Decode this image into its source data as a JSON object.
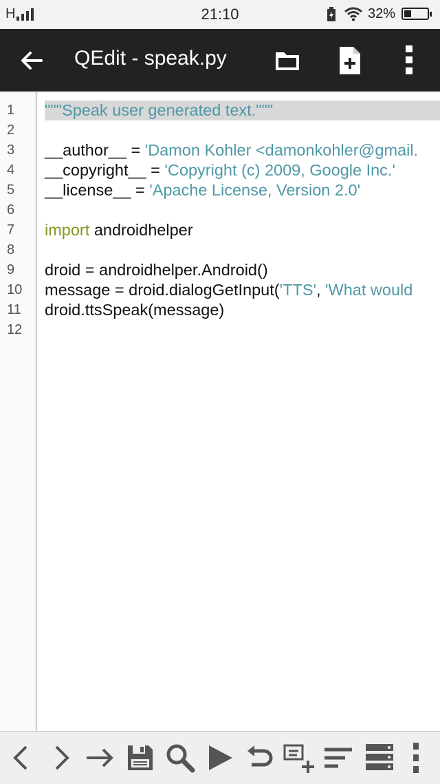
{
  "status_bar": {
    "network": "H",
    "time": "21:10",
    "battery_percent": "32%",
    "battery_level": 0.32,
    "icons": [
      "signal-icon",
      "battery-saver-icon",
      "wifi-icon",
      "battery-icon"
    ]
  },
  "app_bar": {
    "title": "QEdit - speak.py",
    "icons": [
      "back-arrow-icon",
      "folder-icon",
      "new-file-icon",
      "overflow-menu-icon"
    ]
  },
  "editor": {
    "line_numbers": [
      "1",
      "2",
      "3",
      "4",
      "5",
      "6",
      "7",
      "8",
      "9",
      "10",
      "11",
      "12"
    ],
    "current_line": 1,
    "lines": [
      [
        {
          "t": "str",
          "v": "\"\"\"Speak user generated text.\"\"\""
        }
      ],
      [],
      [
        {
          "t": "plain",
          "v": "__author__ = "
        },
        {
          "t": "str",
          "v": "'Damon Kohler <damonkohler@gmail."
        }
      ],
      [
        {
          "t": "plain",
          "v": "__copyright__ = "
        },
        {
          "t": "str",
          "v": "'Copyright (c) 2009, Google Inc.'"
        }
      ],
      [
        {
          "t": "plain",
          "v": "__license__ = "
        },
        {
          "t": "str",
          "v": "'Apache License, Version 2.0'"
        }
      ],
      [],
      [
        {
          "t": "kw",
          "v": "import"
        },
        {
          "t": "plain",
          "v": " androidhelper"
        }
      ],
      [],
      [
        {
          "t": "plain",
          "v": "droid = androidhelper.Android()"
        }
      ],
      [
        {
          "t": "plain",
          "v": "message = droid.dialogGetInput("
        },
        {
          "t": "str",
          "v": "'TTS'"
        },
        {
          "t": "plain",
          "v": ", "
        },
        {
          "t": "str",
          "v": "'What would"
        }
      ],
      [
        {
          "t": "plain",
          "v": "droid.ttsSpeak(message)"
        }
      ],
      []
    ],
    "colors": {
      "string": "#4f98a7",
      "keyword": "#7f9a1f",
      "text": "#111111",
      "current_line_bg": "#d8d8d8"
    }
  },
  "toolbar": {
    "icons": [
      "chevron-left-icon",
      "chevron-right-icon",
      "arrow-right-icon",
      "save-icon",
      "search-icon",
      "run-icon",
      "undo-icon",
      "add-snippet-icon",
      "format-text-icon",
      "list-view-icon",
      "more-vert-icon"
    ]
  }
}
